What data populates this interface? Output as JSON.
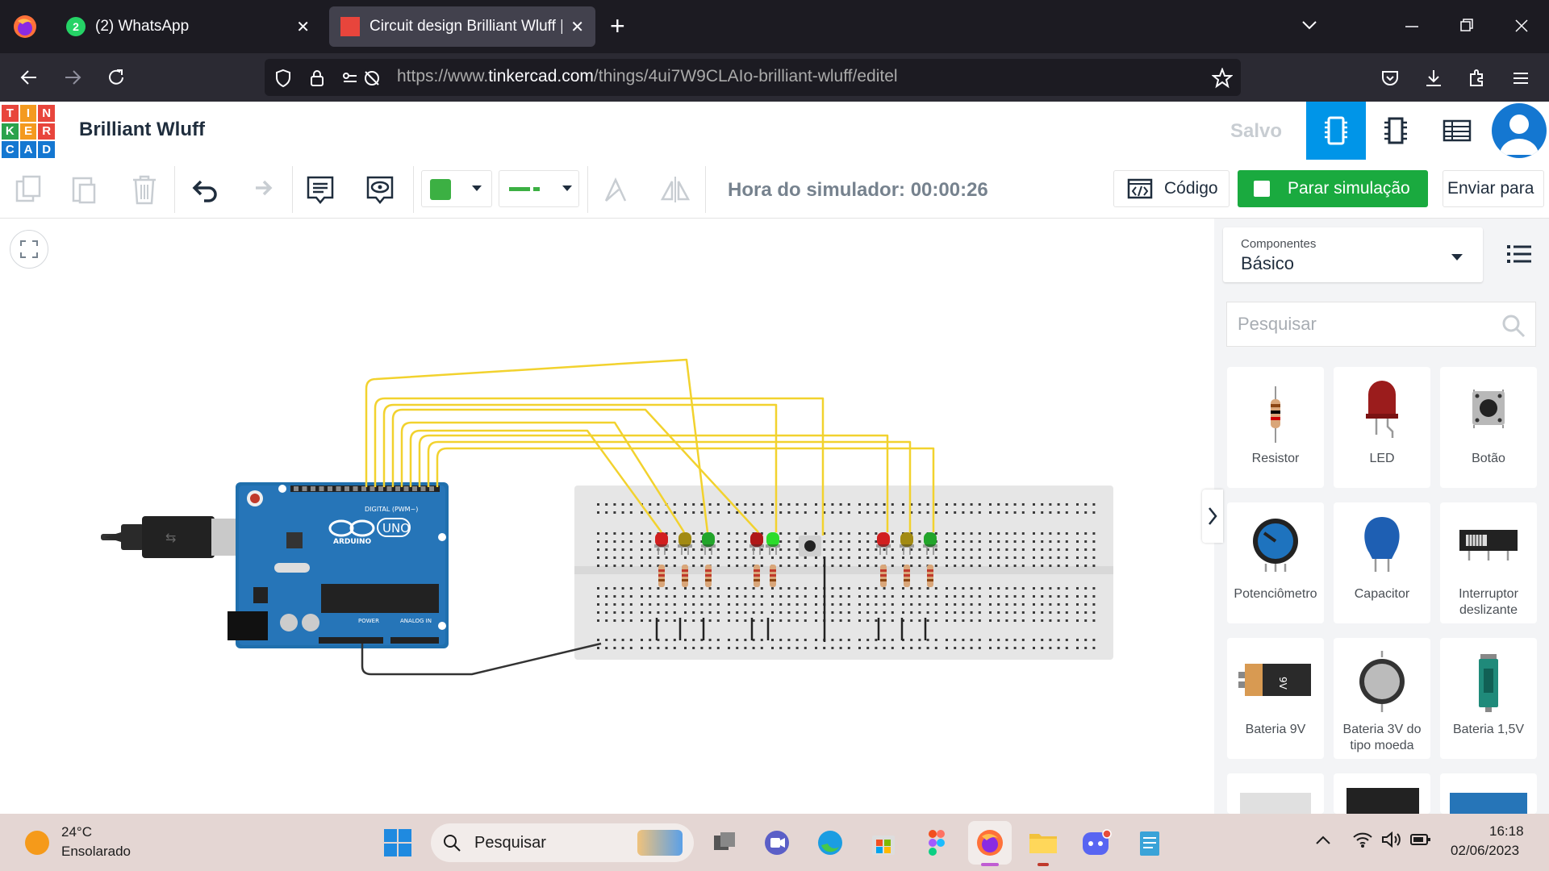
{
  "browser": {
    "tabs": [
      {
        "label": "(2) WhatsApp",
        "badge": "2"
      },
      {
        "label": "Circuit design Brilliant Wluff | Ti"
      }
    ],
    "url": {
      "prefix": "https://www.",
      "domain": "tinkercad.com",
      "path": "/things/4ui7W9CLAIo-brilliant-wluff/editel"
    },
    "new_tab": "+"
  },
  "app": {
    "logo_letters": [
      "T",
      "I",
      "N",
      "K",
      "E",
      "R",
      "C",
      "A",
      "D"
    ],
    "project_title": "Brilliant Wluff",
    "save_status": "Salvo"
  },
  "toolbar": {
    "sim_time_label": "Hora do simulador: 00:00:26",
    "code_label": "Código",
    "stop_sim_label": "Parar simulação",
    "send_label": "Enviar para",
    "fill_color": "#3cb043"
  },
  "panel": {
    "components_caption": "Componentes",
    "components_selected": "Básico",
    "search_placeholder": "Pesquisar",
    "items": [
      {
        "label": "Resistor",
        "icon": "resistor-icon"
      },
      {
        "label": "LED",
        "icon": "led-icon"
      },
      {
        "label": "Botão",
        "icon": "pushbutton-icon"
      },
      {
        "label": "Potenciômetro",
        "icon": "potentiometer-icon"
      },
      {
        "label": "Capacitor",
        "icon": "capacitor-icon"
      },
      {
        "label": "Interruptor deslizante",
        "icon": "slide-switch-icon"
      },
      {
        "label": "Bateria 9V",
        "icon": "battery-9v-icon"
      },
      {
        "label": "Bateria 3V do tipo moeda",
        "icon": "coin-battery-icon"
      },
      {
        "label": "Bateria 1,5V",
        "icon": "battery-aa-icon"
      }
    ]
  },
  "circuit": {
    "board_brand": "ARDUINO",
    "board_model": "UNO",
    "board_header_label": "DIGITAL (PWM~)",
    "power_label": "POWER",
    "analog_label": "ANALOG IN",
    "battery_text": "9V",
    "wire_color": "#f2d22e",
    "ground_wire_color": "#333333"
  },
  "taskbar": {
    "weather_temp": "24°C",
    "weather_desc": "Ensolarado",
    "search_label": "Pesquisar",
    "time": "16:18",
    "date": "02/06/2023"
  }
}
